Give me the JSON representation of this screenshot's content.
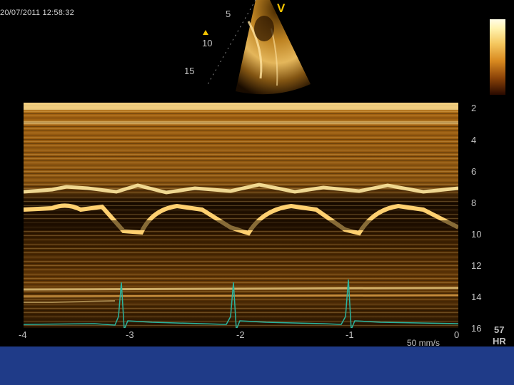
{
  "header": {
    "datetime": "20/07/2011 12:58:32",
    "mode_marker": "V"
  },
  "sector": {
    "depth_labels": [
      "5",
      "10",
      "15"
    ]
  },
  "mmode": {
    "depth_labels": [
      "2",
      "4",
      "6",
      "8",
      "10",
      "12",
      "14",
      "16"
    ],
    "time_labels": [
      "-4",
      "-3",
      "-2",
      "-1",
      "0"
    ],
    "sweep_speed": "50 mm/s"
  },
  "heart_rate": {
    "value": "57",
    "label": "HR"
  },
  "colors": {
    "background": "#000000",
    "ecg_trace": "#2ab5a0",
    "echo_bright": "#ffe9a0",
    "echo_mid": "#d08a20",
    "bottom_band": "#1f3b88",
    "marker": "#f2c200"
  },
  "icons": [
    "sector-scan-image",
    "grayscale-colorbar",
    "ecg-trace"
  ]
}
